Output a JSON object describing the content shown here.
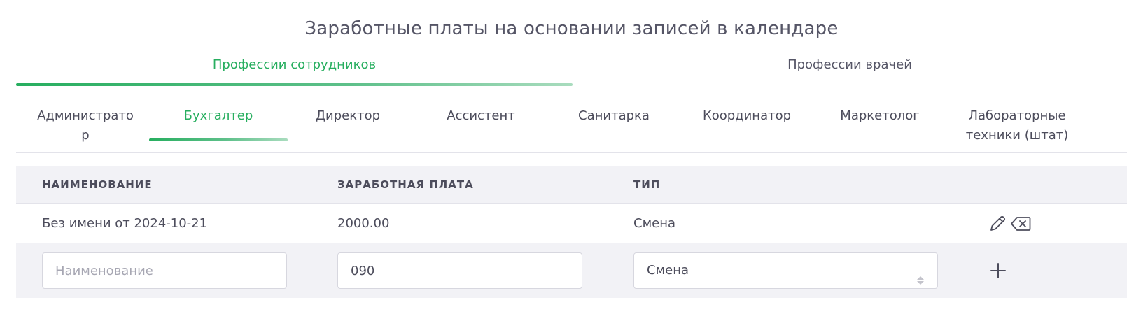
{
  "page": {
    "title": "Заработные платы на основании записей в календаре"
  },
  "main_tabs": [
    {
      "label": "Профессии сотрудников",
      "active": true
    },
    {
      "label": "Профессии врачей",
      "active": false
    }
  ],
  "sub_tabs": [
    {
      "label": "Администрато р",
      "active": false
    },
    {
      "label": "Бухгалтер",
      "active": true
    },
    {
      "label": "Директор",
      "active": false
    },
    {
      "label": "Ассистент",
      "active": false
    },
    {
      "label": "Санитарка",
      "active": false
    },
    {
      "label": "Координатор",
      "active": false
    },
    {
      "label": "Маркетолог",
      "active": false
    },
    {
      "label": "Лабораторные техники (штат)",
      "active": false
    }
  ],
  "table": {
    "headers": {
      "name": "НАИМЕНОВАНИЕ",
      "salary": "ЗАРАБОТНАЯ ПЛАТА",
      "type": "ТИП"
    },
    "rows": [
      {
        "name": "Без имени от 2024-10-21",
        "salary": "2000.00",
        "type": "Смена",
        "actions": [
          "edit-icon",
          "delete-icon"
        ]
      }
    ]
  },
  "form": {
    "name_placeholder": "Наименование",
    "name_value": "",
    "salary_value": "090",
    "type_selected": "Смена",
    "add_icon": "plus-icon"
  },
  "colors": {
    "accent": "#27ae5f",
    "text": "#4d4d5c",
    "header_bg": "#f2f2f6",
    "border": "#e3e3ea"
  }
}
